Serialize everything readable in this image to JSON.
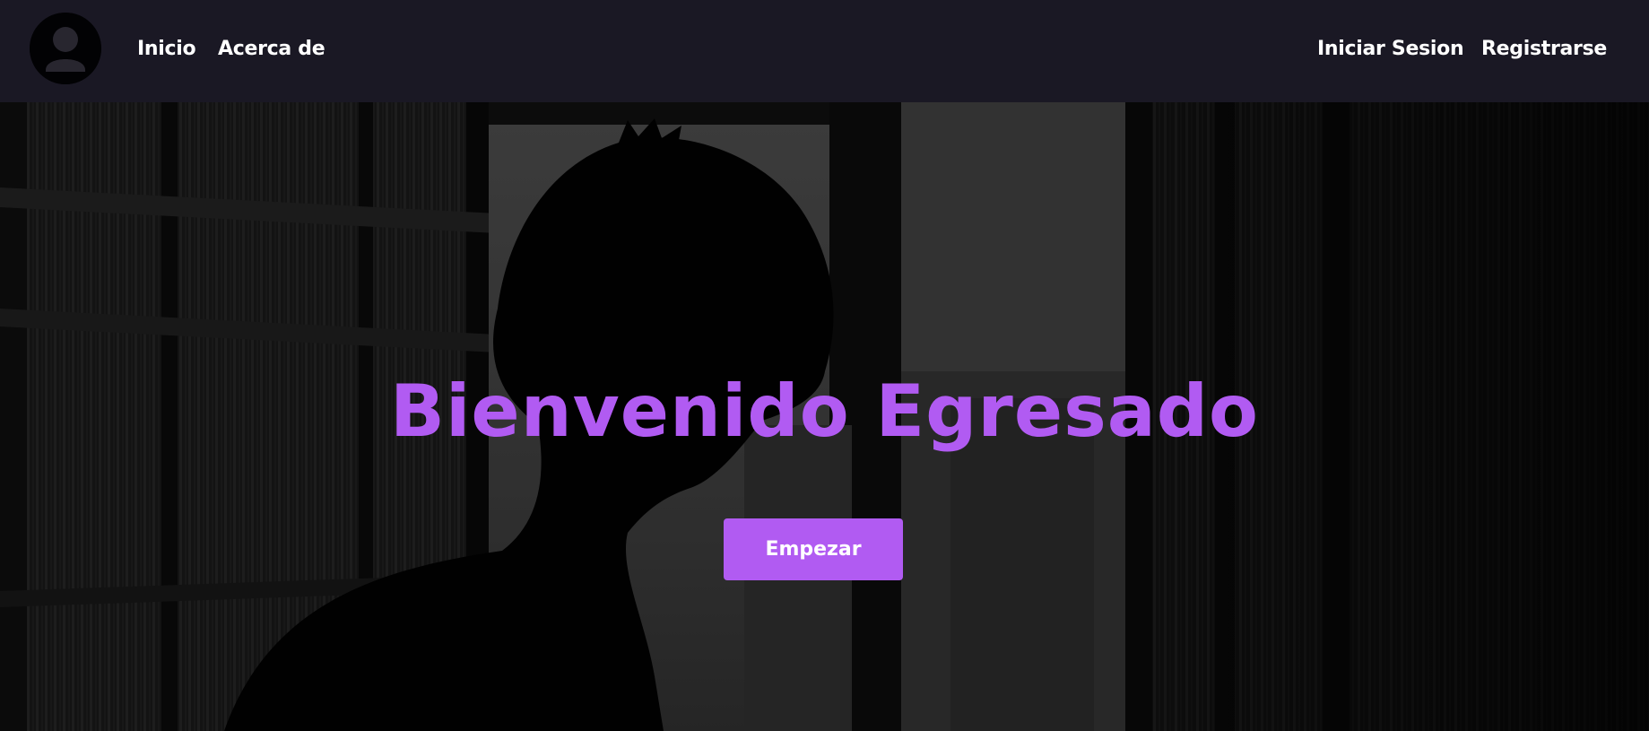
{
  "navbar": {
    "avatar_icon": "user-avatar-icon",
    "links": {
      "inicio": "Inicio",
      "acerca": "Acerca de",
      "login": "Iniciar Sesion",
      "register": "Registrarse"
    }
  },
  "hero": {
    "title": "Bienvenido Egresado",
    "cta_label": "Empezar"
  },
  "colors": {
    "navbar_bg": "#1a1824",
    "accent": "#b15bf2",
    "text": "#ffffff"
  }
}
